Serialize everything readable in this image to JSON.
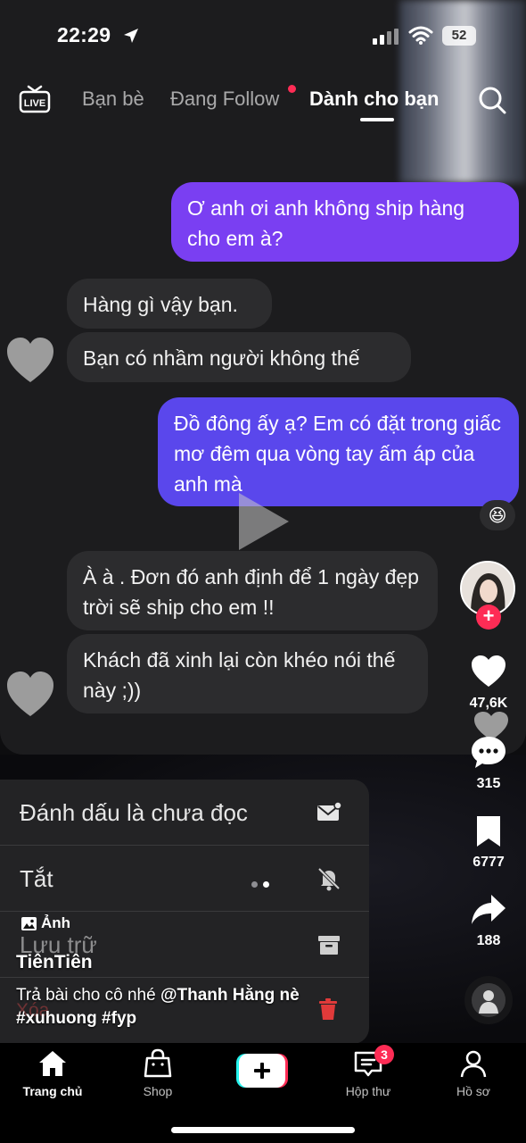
{
  "status_bar": {
    "time": "22:29",
    "battery": "52"
  },
  "top_nav": {
    "tabs": [
      {
        "label": "Bạn bè"
      },
      {
        "label": "Đang Follow"
      },
      {
        "label": "Dành cho bạn"
      }
    ]
  },
  "chat": {
    "messages": [
      {
        "from": "me",
        "text": "Ơ anh ơi anh không ship hàng cho em à?"
      },
      {
        "from": "them",
        "text": "Hàng gì vậy bạn."
      },
      {
        "from": "them",
        "text": "Bạn có nhầm người không thế"
      },
      {
        "from": "me",
        "text": "Đồ đông ấy ạ? Em có đặt trong giấc mơ đêm qua vòng tay ấm áp của anh mà"
      },
      {
        "from": "them",
        "text": "À à . Đơn đó anh định để 1 ngày đẹp trời sẽ ship cho em !!"
      },
      {
        "from": "them",
        "text": "Khách  đã xinh lại còn khéo nói thế này ;))"
      }
    ],
    "reaction": "😆"
  },
  "context_menu": {
    "items": [
      {
        "label": "Đánh dấu là chưa đọc"
      },
      {
        "label": "Tắt"
      },
      {
        "label": "Lưu trữ"
      },
      {
        "label": "Xóa"
      }
    ]
  },
  "post": {
    "photo_tag": "Ảnh",
    "author": "TiênTiên",
    "caption_text": "Trả bài cho cô nhé ",
    "mention": "@Thanh Hằng nè",
    "hashtags": "#xuhuong #fyp"
  },
  "rail": {
    "likes": "47,6K",
    "comments": "315",
    "saves": "6777",
    "shares": "188"
  },
  "bottom_nav": {
    "items": [
      {
        "label": "Trang chủ"
      },
      {
        "label": "Shop"
      },
      {
        "label": ""
      },
      {
        "label": "Hộp thư"
      },
      {
        "label": "Hồ sơ"
      }
    ],
    "inbox_badge": "3"
  },
  "colors": {
    "accent": "#fe2c55",
    "bubble_me": "#7a3ff2",
    "bubble_me_blue": "#5a47ec",
    "bubble_them": "#2c2c2e"
  }
}
